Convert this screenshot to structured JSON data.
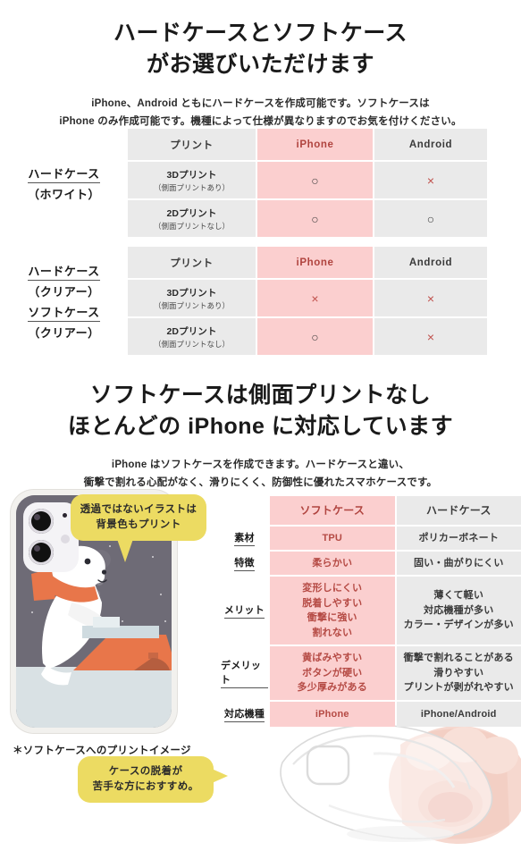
{
  "section1": {
    "heading_lines": [
      "ハードケースとソフトケース",
      "がお選びいただけます"
    ],
    "lead_lines": [
      "iPhone、Android ともにハードケースを作成可能です。ソフトケースは",
      "iPhone のみ作成可能です。機種によって仕様が異なりますのでお気を付けください。"
    ]
  },
  "table1": {
    "label": {
      "line1": "ハードケース",
      "line2": "（ホワイト）"
    },
    "headers": [
      "プリント",
      "iPhone",
      "Android"
    ],
    "rows": [
      {
        "main": "3Dプリント",
        "sub": "（側面プリントあり）",
        "iphone": "○",
        "android": "×"
      },
      {
        "main": "2Dプリント",
        "sub": "（側面プリントなし）",
        "iphone": "○",
        "android": "○"
      }
    ]
  },
  "table2": {
    "label": {
      "line1": "ハードケース",
      "line2": "（クリアー）",
      "line3": "ソフトケース",
      "line4": "（クリアー）"
    },
    "headers": [
      "プリント",
      "iPhone",
      "Android"
    ],
    "rows": [
      {
        "main": "3Dプリント",
        "sub": "（側面プリントあり）",
        "iphone": "×",
        "android": "×"
      },
      {
        "main": "2Dプリント",
        "sub": "（側面プリントなし）",
        "iphone": "○",
        "android": "×"
      }
    ]
  },
  "section2": {
    "heading_lines": [
      "ソフトケースは側面プリントなし",
      "ほとんどの iPhone に対応しています"
    ],
    "lead_lines": [
      "iPhone はソフトケースを作成できます。ハードケースと違い、",
      "衝撃で割れる心配がなく、滑りにくく、防御性に優れたスマホケースです。"
    ]
  },
  "callouts": {
    "illustration": {
      "line1": "透過ではないイラストは",
      "line2": "背景色もプリント"
    },
    "clearcase": {
      "line1": "ケースの脱着が",
      "line2": "苦手な方におすすめ。"
    }
  },
  "phone_caption": "＊ソフトケースへのプリントイメージ",
  "comparison": {
    "headers": [
      "ソフトケース",
      "ハードケース"
    ],
    "rows": [
      {
        "label": "素材",
        "soft": [
          "TPU"
        ],
        "hard": [
          "ポリカーボネート"
        ]
      },
      {
        "label": "特徴",
        "soft": [
          "柔らかい"
        ],
        "hard": [
          "固い・曲がりにくい"
        ]
      },
      {
        "label": "メリット",
        "soft": [
          "変形しにくい",
          "脱着しやすい",
          "衝撃に強い",
          "割れない"
        ],
        "hard": [
          "薄くて軽い",
          "対応機種が多い",
          "カラー・デザインが多い"
        ]
      },
      {
        "label": "デメリット",
        "soft": [
          "黄ばみやすい",
          "ボタンが硬い",
          "多少厚みがある"
        ],
        "hard": [
          "衝撃で割れることがある",
          "滑りやすい",
          "プリントが剥がれやすい"
        ]
      },
      {
        "label": "対応機種",
        "soft": [
          "iPhone"
        ],
        "hard": [
          "iPhone/Android"
        ]
      }
    ]
  },
  "colors": {
    "pink": "#fbcfcf",
    "gray": "#eaeaea",
    "pink_text": "#b0443f",
    "yellow": "#ecdb62",
    "orange": "#e8764a",
    "night": "#6e6b76",
    "snow": "#d9e1e4"
  }
}
